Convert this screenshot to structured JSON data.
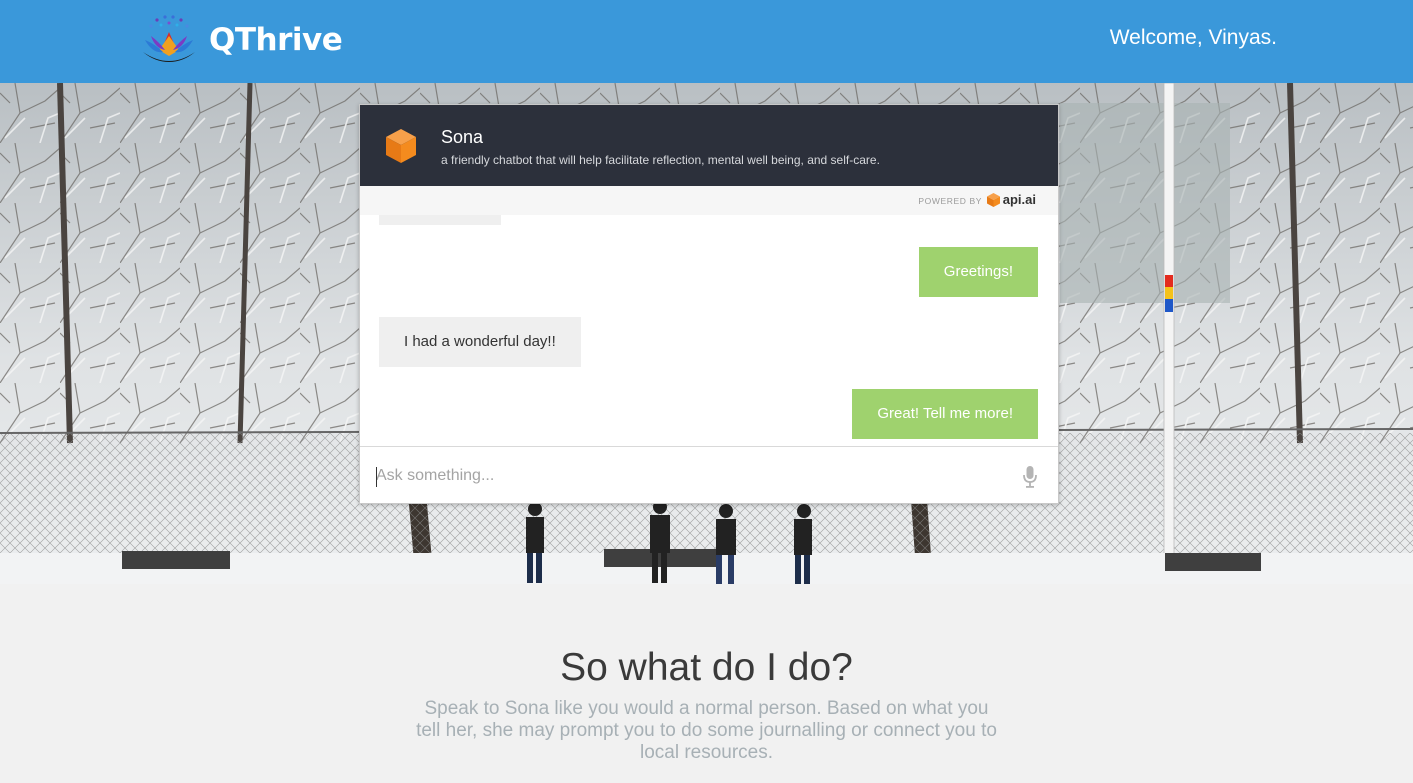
{
  "navbar": {
    "brand": "QThrive",
    "welcome": "Welcome, Vinyas.",
    "color": "#3a98da"
  },
  "chat": {
    "bot_name": "Sona",
    "bot_description": "a friendly chatbot that will help facilitate reflection, mental well being, and self-care.",
    "powered_by_label": "POWERED BY",
    "powered_by_brand": "api.ai",
    "messages": [
      {
        "sender": "bot",
        "text": ""
      },
      {
        "sender": "user",
        "text": "Greetings!"
      },
      {
        "sender": "bot",
        "text": "I had a wonderful day!!"
      },
      {
        "sender": "user",
        "text": "Great! Tell me more!"
      }
    ],
    "input": {
      "placeholder": "Ask something...",
      "value": ""
    },
    "colors": {
      "header": "#2c303b",
      "user_bubble": "#9fd26e",
      "bot_bubble": "#efefef",
      "accent": "#f48b1e"
    }
  },
  "info": {
    "title": "So what do I do?",
    "text": "Speak to Sona like you would a normal person. Based on what you tell her, she may prompt you to do some journalling or connect you to local resources."
  }
}
